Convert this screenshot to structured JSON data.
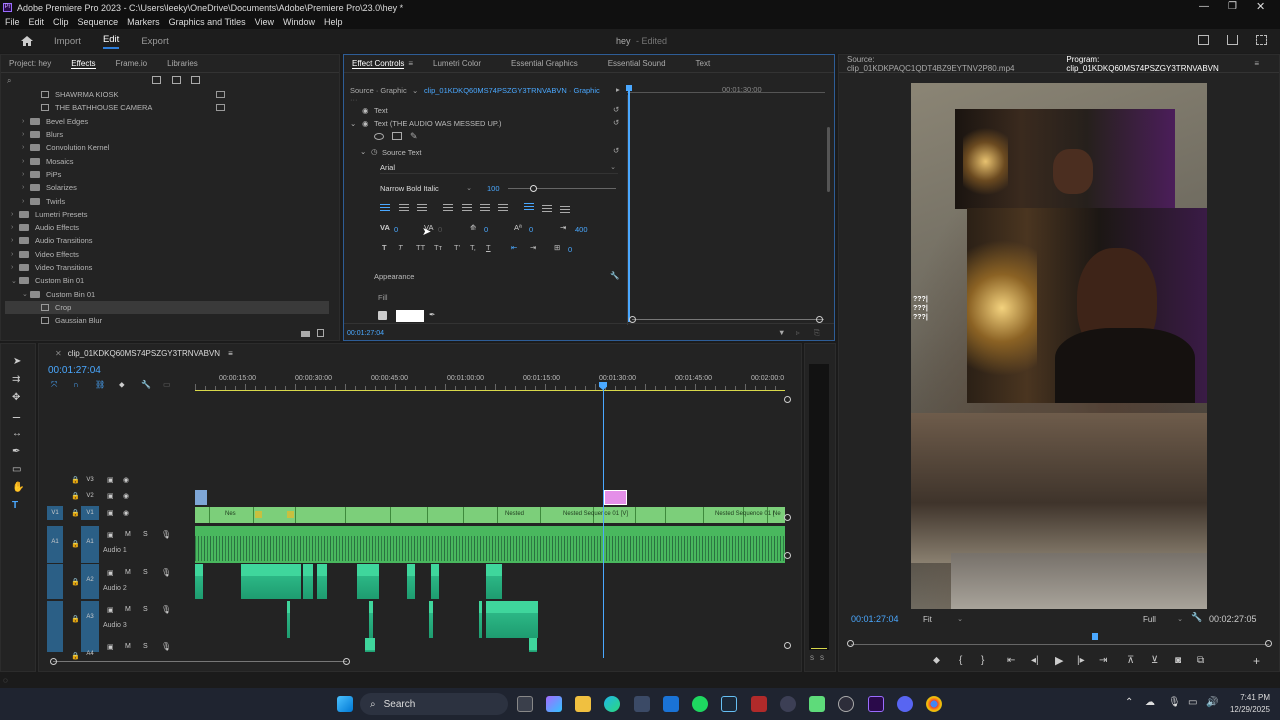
{
  "window": {
    "title": "Adobe Premiere Pro 2023 - C:\\Users\\leeky\\OneDrive\\Documents\\Adobe\\Premiere Pro\\23.0\\hey *",
    "controls": [
      "—",
      "❐",
      "✕"
    ]
  },
  "menu": [
    "File",
    "Edit",
    "Clip",
    "Sequence",
    "Markers",
    "Graphics and Titles",
    "View",
    "Window",
    "Help"
  ],
  "workspace": {
    "tabs": [
      "Import",
      "Edit",
      "Export"
    ],
    "active": "Edit",
    "project_name": "hey",
    "project_status": "- Edited"
  },
  "left_panel": {
    "tabs": [
      "Project: hey",
      "Effects",
      "Frame.io",
      "Libraries"
    ],
    "active_tab": "Effects",
    "tree": [
      {
        "label": "SHAWRMA KIOSK",
        "indent": 2,
        "type": "preset"
      },
      {
        "label": "THE BATHHOUSE CAMERA",
        "indent": 2,
        "type": "preset"
      },
      {
        "label": "Bevel Edges",
        "indent": 1,
        "type": "folder"
      },
      {
        "label": "Blurs",
        "indent": 1,
        "type": "folder"
      },
      {
        "label": "Convolution Kernel",
        "indent": 1,
        "type": "folder"
      },
      {
        "label": "Mosaics",
        "indent": 1,
        "type": "folder"
      },
      {
        "label": "PiPs",
        "indent": 1,
        "type": "folder"
      },
      {
        "label": "Solarizes",
        "indent": 1,
        "type": "folder"
      },
      {
        "label": "Twirls",
        "indent": 1,
        "type": "folder"
      },
      {
        "label": "Lumetri Presets",
        "indent": 0,
        "type": "folder"
      },
      {
        "label": "Audio Effects",
        "indent": 0,
        "type": "folder"
      },
      {
        "label": "Audio Transitions",
        "indent": 0,
        "type": "folder"
      },
      {
        "label": "Video Effects",
        "indent": 0,
        "type": "folder"
      },
      {
        "label": "Video Transitions",
        "indent": 0,
        "type": "folder"
      },
      {
        "label": "Custom Bin 01",
        "indent": 0,
        "type": "folder-open"
      },
      {
        "label": "Custom Bin 01",
        "indent": 1,
        "type": "folder-open"
      },
      {
        "label": "Crop",
        "indent": 2,
        "type": "effect",
        "selected": true
      },
      {
        "label": "Gaussian Blur",
        "indent": 2,
        "type": "effect"
      }
    ]
  },
  "effect_controls": {
    "tabs": [
      "Effect Controls",
      "Lumetri Color",
      "Essential Graphics",
      "Essential Sound",
      "Text"
    ],
    "active_tab": "Effect Controls",
    "source_label": "Source · Graphic",
    "clip_label": "clip_01KDKQ60MS74PSZGY3TRNVABVN · Graphic",
    "timecode_ruler": "00:01:30:00",
    "text_row": "Text",
    "text_layer": "Text (THE AUDIO WAS MESSED UP.)",
    "source_text": "Source Text",
    "font": "Arial",
    "font_style": "Narrow Bold Italic",
    "font_size": "100",
    "tracking_values": [
      "0",
      "0",
      "0",
      "0",
      "400"
    ],
    "baseline_value": "0",
    "appearance": "Appearance",
    "fill": "Fill",
    "current_time": "00:01:27:04"
  },
  "program_monitor": {
    "source_tab": "Source: clip_01KDKPAQC1QDT4BZ9EYTNV2P80.mp4",
    "program_tab": "Program: clip_01KDKQ60MS74PSZGY3TRNVABVN",
    "timecode": "00:01:27:04",
    "fit": "Fit",
    "quality": "Full",
    "duration": "00:02:27:05",
    "overlay_text": [
      "???|",
      "???|",
      "???|"
    ]
  },
  "timeline": {
    "sequence_name": "clip_01KDKQ60MS74PSZGY3TRNVABVN",
    "timecode": "00:01:27:04",
    "ruler": [
      "00:00:15:00",
      "00:00:30:00",
      "00:00:45:00",
      "00:01:00:00",
      "00:01:15:00",
      "00:01:30:00",
      "00:01:45:00",
      "00:02:00:0"
    ],
    "video_tracks": [
      "V3",
      "V2",
      "V1"
    ],
    "audio_tracks": [
      {
        "id": "A1",
        "name": "Audio 1"
      },
      {
        "id": "A2",
        "name": "Audio 2"
      },
      {
        "id": "A3",
        "name": "Audio 3"
      },
      {
        "id": "A4",
        "name": ""
      }
    ],
    "v1_clip_labels": [
      "Nes",
      "Nested",
      "Nested Sequence 01 [V]",
      "Nested Sequence 01 [",
      "Ne"
    ],
    "mute_label": "M",
    "solo_label": "S",
    "meter_labels": [
      "S",
      "S"
    ]
  },
  "taskbar": {
    "search": "Search",
    "time": "7:41 PM",
    "date": "12/29/2025"
  },
  "colors": {
    "accent": "#2e5d96",
    "timecode": "#4aa8ff",
    "playhead": "#4aa8ff",
    "clip_video": "#7ccf7a",
    "clip_audio": "#49b85e",
    "clip_graphic": "#e48fe8"
  }
}
